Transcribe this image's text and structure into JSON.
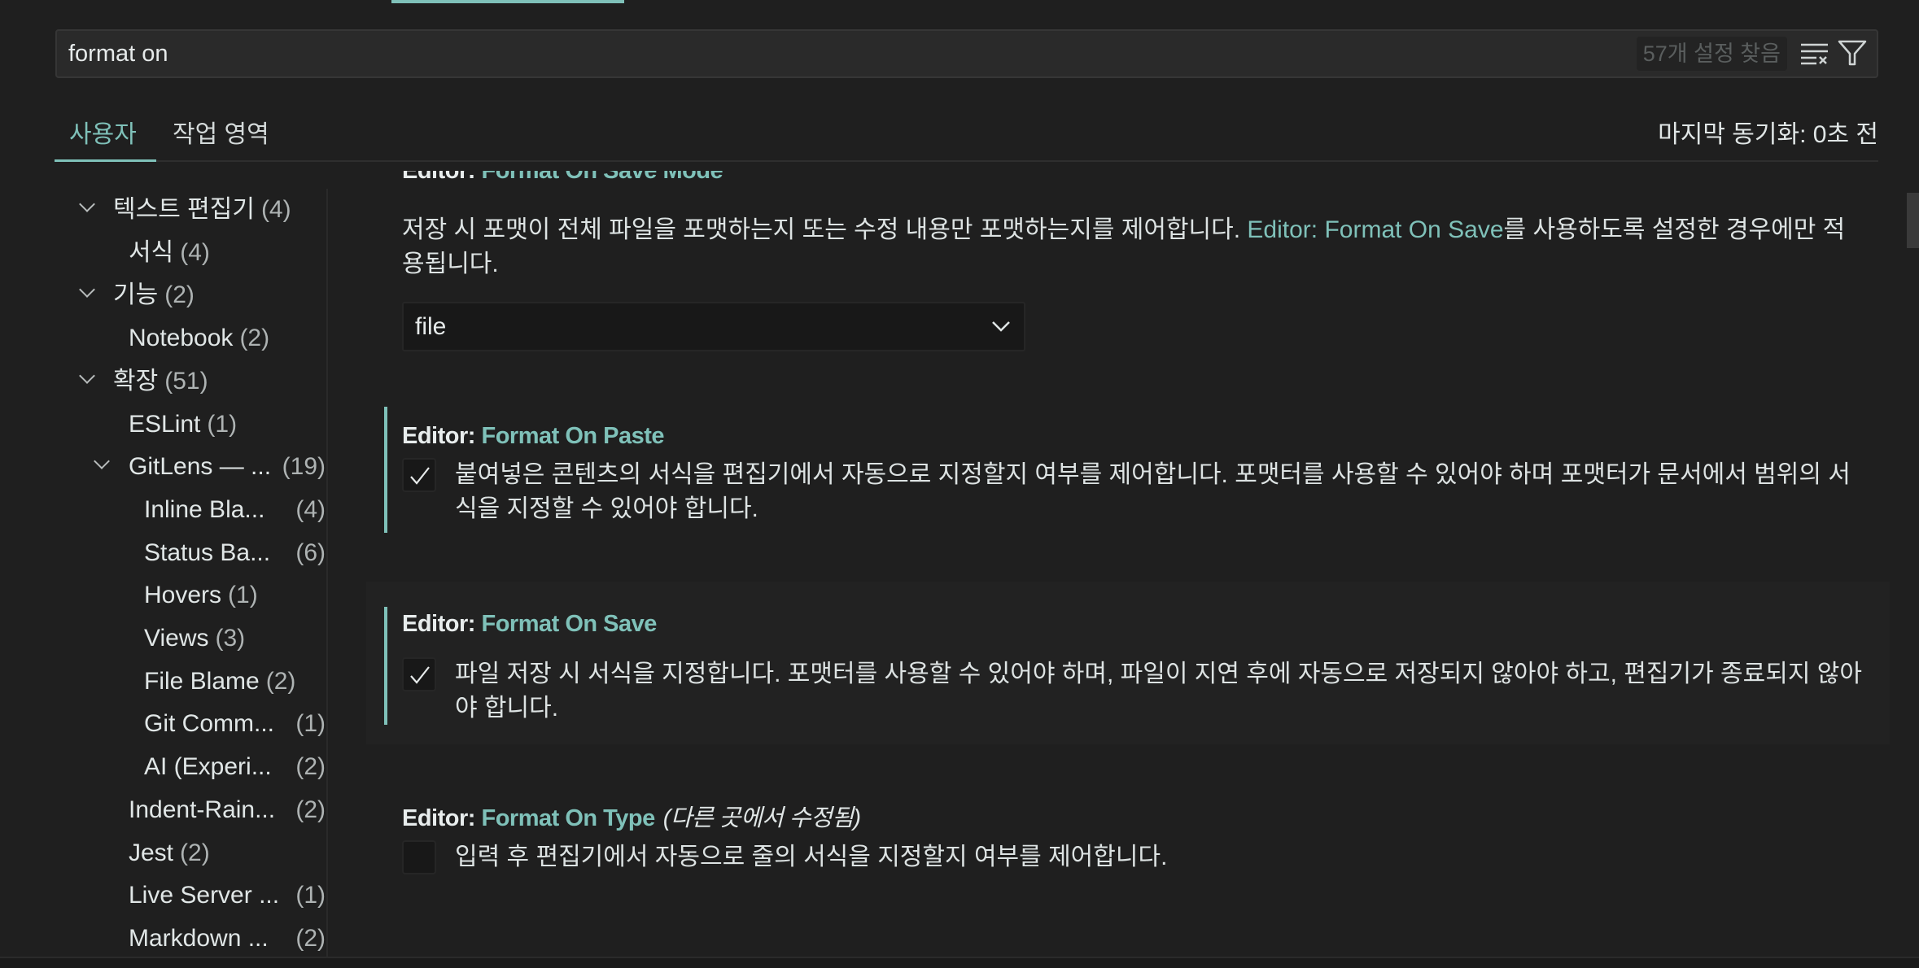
{
  "search": {
    "value": "format on",
    "result_count": "57개 설정 찾음",
    "clear_icon": "clear-filter-icon",
    "filter_icon": "filter-icon"
  },
  "tabs": [
    {
      "label": "사용자",
      "active": true
    },
    {
      "label": "작업 영역",
      "active": false
    }
  ],
  "sync_status": "마지막 동기화: 0초 전",
  "accent_color": "#7fc1b9",
  "toc": [
    {
      "label": "텍스트 편집기",
      "count": "(4)",
      "expanded": true
    },
    {
      "label": "서식",
      "count": "(4)"
    },
    {
      "label": "기능",
      "count": "(2)",
      "expanded": true
    },
    {
      "label": "Notebook",
      "count": "(2)"
    },
    {
      "label": "확장",
      "count": "(51)",
      "expanded": true
    },
    {
      "label": "ESLint",
      "count": "(1)"
    },
    {
      "label": "GitLens — ...",
      "count": "(19)",
      "expanded": true
    },
    {
      "label": "Inline Bla...",
      "count": "(4)"
    },
    {
      "label": "Status Ba...",
      "count": "(6)"
    },
    {
      "label": "Hovers",
      "count": "(1)"
    },
    {
      "label": "Views",
      "count": "(3)"
    },
    {
      "label": "File Blame",
      "count": "(2)"
    },
    {
      "label": "Git Comm...",
      "count": "(1)"
    },
    {
      "label": "AI (Experi...",
      "count": "(2)"
    },
    {
      "label": "Indent-Rain...",
      "count": "(2)"
    },
    {
      "label": "Jest",
      "count": "(2)"
    },
    {
      "label": "Live Server ...",
      "count": "(1)"
    },
    {
      "label": "Markdown ...",
      "count": "(2)"
    }
  ],
  "settings": [
    {
      "category": "Editor: ",
      "name": "Format On Save Mode",
      "desc_before": "저장 시 포맷이 전체 파일을 포맷하는지 또는 수정 내용만 포맷하는지를 제어합니다. ",
      "desc_link": "Editor: Format On Save",
      "desc_after": "를 사용하도록 설정한 경우에만 적용됩니다.",
      "value": "file"
    },
    {
      "category": "Editor: ",
      "name": "Format On Paste",
      "checked": true,
      "desc": "붙여넣은 콘텐츠의 서식을 편집기에서 자동으로 지정할지 여부를 제어합니다. 포맷터를 사용할 수 있어야 하며 포맷터가 문서에서 범위의 서식을 지정할 수 있어야 합니다."
    },
    {
      "category": "Editor: ",
      "name": "Format On Save",
      "checked": true,
      "desc": "파일 저장 시 서식을 지정합니다. 포맷터를 사용할 수 있어야 하며, 파일이 지연 후에 자동으로 저장되지 않아야 하고, 편집기가 종료되지 않아야 합니다."
    },
    {
      "category": "Editor: ",
      "name": "Format On Type",
      "modified": "(다른 곳에서 수정됨)",
      "checked": false,
      "desc": "입력 후 편집기에서 자동으로 줄의 서식을 지정할지 여부를 제어합니다."
    }
  ]
}
